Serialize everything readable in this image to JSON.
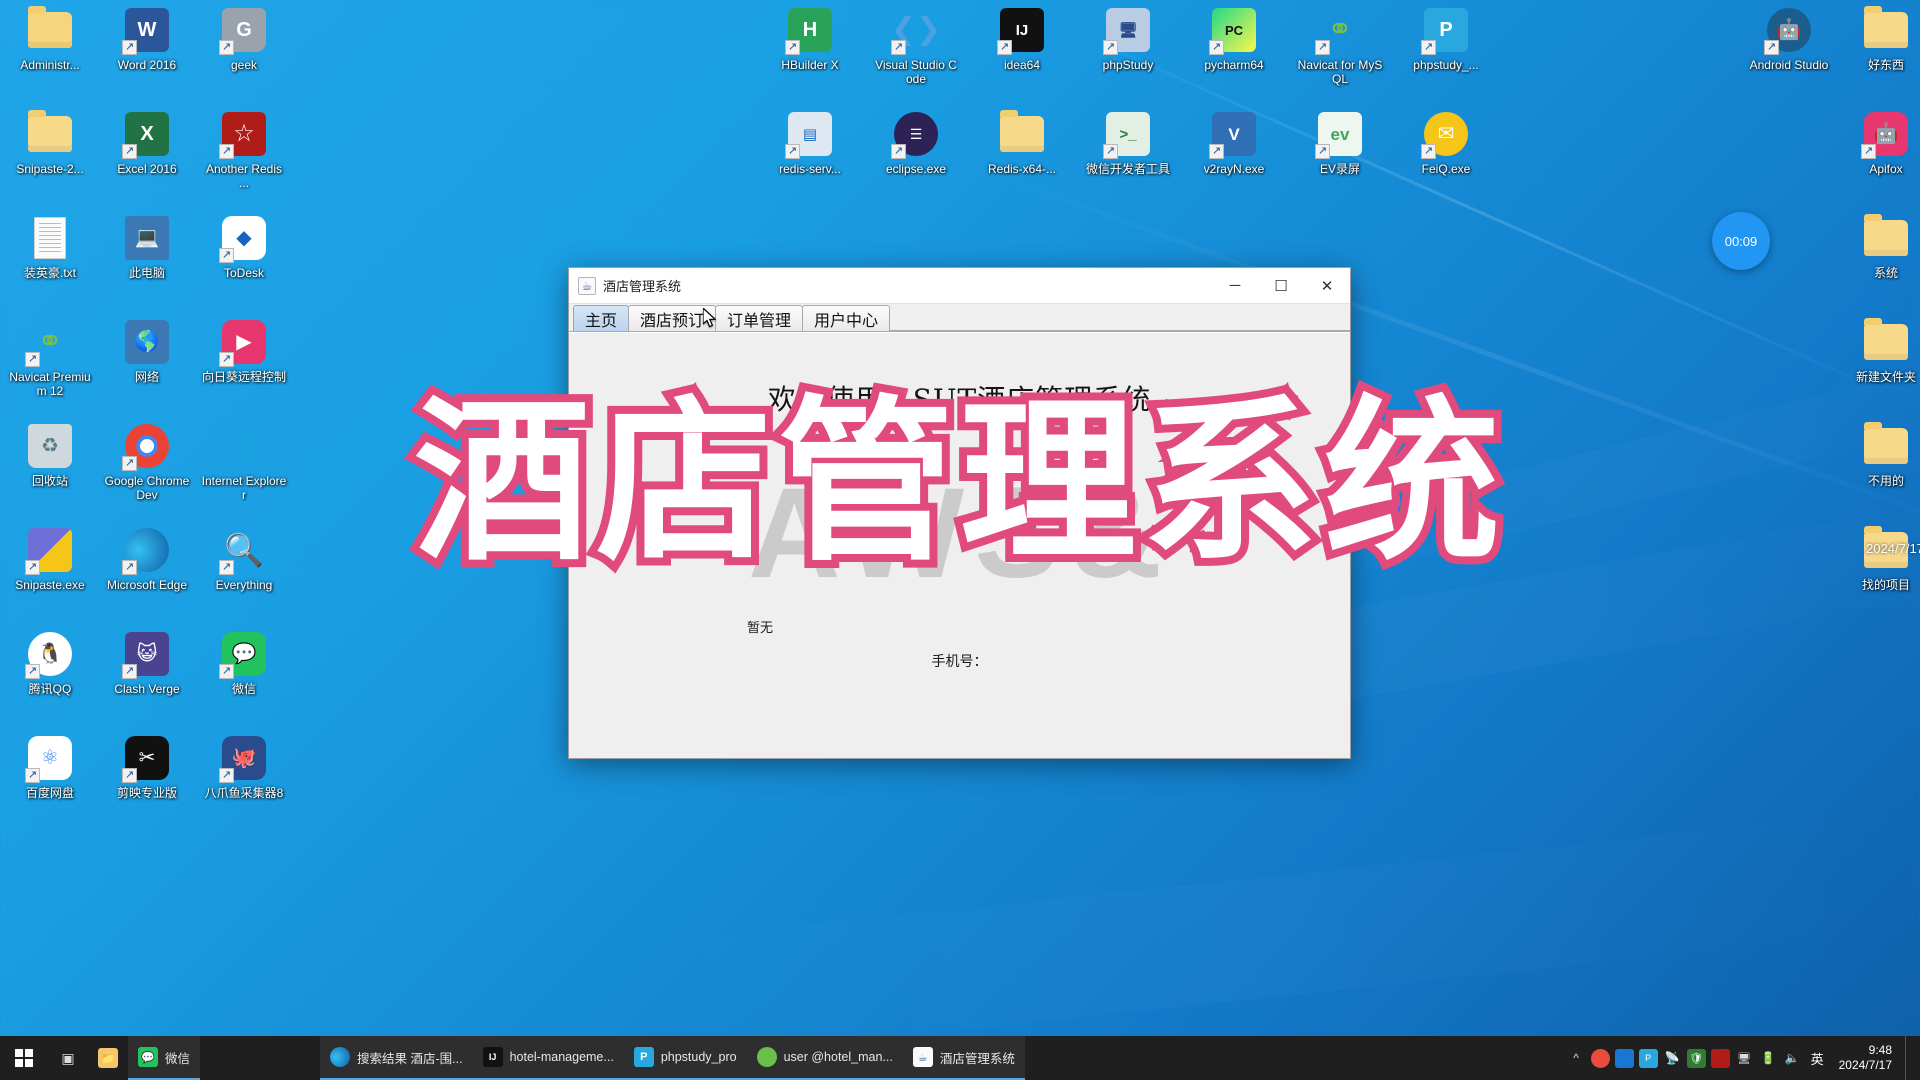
{
  "desktop": {
    "columns": [
      {
        "name": "left-column",
        "icons": [
          {
            "label": "Administr...",
            "icon": "user-folder-icon",
            "kind": "folder-user",
            "shortcut": false
          },
          {
            "label": "Word 2016",
            "icon": "word-icon",
            "kind": "word",
            "shortcut": true
          },
          {
            "label": "geek",
            "icon": "geek-uninstaller-icon",
            "kind": "geek",
            "shortcut": true
          },
          {
            "label": "Snipaste-2...",
            "icon": "folder-icon",
            "kind": "folder",
            "shortcut": false
          },
          {
            "label": "Excel 2016",
            "icon": "excel-icon",
            "kind": "excel",
            "shortcut": true
          },
          {
            "label": "Another Redis ...",
            "icon": "another-redis-desktop-manager-icon",
            "kind": "redis-star",
            "shortcut": true
          },
          {
            "label": "装英豪.txt",
            "icon": "text-file-icon",
            "kind": "txt",
            "shortcut": false
          },
          {
            "label": "此电脑",
            "icon": "this-pc-icon",
            "kind": "pc",
            "shortcut": false
          },
          {
            "label": "ToDesk",
            "icon": "todesk-icon",
            "kind": "todesk",
            "shortcut": true
          },
          {
            "label": "Navicat Premium 12",
            "icon": "navicat-premium-icon",
            "kind": "navicat",
            "shortcut": true
          },
          {
            "label": "网络",
            "icon": "network-icon",
            "kind": "network",
            "shortcut": false
          },
          {
            "label": "向日葵远程控制",
            "icon": "sunlogin-icon",
            "kind": "sunlogin",
            "shortcut": true
          },
          {
            "label": "回收站",
            "icon": "recycle-bin-icon",
            "kind": "recycle",
            "shortcut": false
          },
          {
            "label": "Google Chrome Dev",
            "icon": "chrome-dev-icon",
            "kind": "chrome",
            "shortcut": true
          },
          {
            "label": "Internet Explorer",
            "icon": "internet-explorer-icon",
            "kind": "ie",
            "shortcut": false
          },
          {
            "label": "Snipaste.exe",
            "icon": "snipaste-icon",
            "kind": "snipaste",
            "shortcut": true
          },
          {
            "label": "Microsoft Edge",
            "icon": "microsoft-edge-icon",
            "kind": "edge",
            "shortcut": true
          },
          {
            "label": "Everything",
            "icon": "everything-icon",
            "kind": "everything",
            "shortcut": true
          },
          {
            "label": "腾讯QQ",
            "icon": "tencent-qq-icon",
            "kind": "qq",
            "shortcut": true
          },
          {
            "label": "Clash Verge",
            "icon": "clash-verge-icon",
            "kind": "clash",
            "shortcut": true
          },
          {
            "label": "微信",
            "icon": "wechat-icon",
            "kind": "wechat",
            "shortcut": true
          },
          {
            "label": "百度网盘",
            "icon": "baidu-netdisk-icon",
            "kind": "baidu",
            "shortcut": true
          },
          {
            "label": "剪映专业版",
            "icon": "jianying-icon",
            "kind": "jianying",
            "shortcut": true
          },
          {
            "label": "八爪鱼采集器8",
            "icon": "octopus-collector-icon",
            "kind": "octopus",
            "shortcut": true
          }
        ]
      },
      {
        "name": "center-column",
        "icons": [
          {
            "label": "HBuilder X",
            "icon": "hbuilderx-icon",
            "kind": "hbuilder",
            "shortcut": true
          },
          {
            "label": "Visual Studio Code",
            "icon": "vscode-icon",
            "kind": "vscode",
            "shortcut": true
          },
          {
            "label": "idea64",
            "icon": "intellij-idea-icon",
            "kind": "idea",
            "shortcut": true
          },
          {
            "label": "phpStudy",
            "icon": "phpstudy-icon",
            "kind": "phpstudy-old",
            "shortcut": true
          },
          {
            "label": "pycharm64",
            "icon": "pycharm-icon",
            "kind": "pycharm",
            "shortcut": true
          },
          {
            "label": "Navicat for MySQL",
            "icon": "navicat-mysql-icon",
            "kind": "navicat-mysql",
            "shortcut": true
          },
          {
            "label": "phpstudy_...",
            "icon": "phpstudy-pro-icon",
            "kind": "phpstudy-pro",
            "shortcut": true
          },
          {
            "label": "redis-serv...",
            "icon": "redis-server-icon",
            "kind": "redis-server",
            "shortcut": true
          },
          {
            "label": "eclipse.exe",
            "icon": "eclipse-icon",
            "kind": "eclipse",
            "shortcut": true
          },
          {
            "label": "Redis-x64-...",
            "icon": "folder-icon",
            "kind": "folder",
            "shortcut": false
          },
          {
            "label": "微信开发者工具",
            "icon": "wechat-devtools-icon",
            "kind": "wxdev",
            "shortcut": true
          },
          {
            "label": "v2rayN.exe",
            "icon": "v2rayn-icon",
            "kind": "v2rayn",
            "shortcut": true
          },
          {
            "label": "EV录屏",
            "icon": "ev-recorder-icon",
            "kind": "evcapture",
            "shortcut": true
          },
          {
            "label": "FeiQ.exe",
            "icon": "feiq-icon",
            "kind": "feiq",
            "shortcut": true
          }
        ]
      },
      {
        "name": "right-column",
        "icons": [
          {
            "label": "Android Studio",
            "icon": "android-studio-icon",
            "kind": "android",
            "shortcut": true
          },
          {
            "label": "好东西",
            "icon": "folder-icon",
            "kind": "folder",
            "shortcut": false
          },
          {
            "label": "Apifox",
            "icon": "apifox-icon",
            "kind": "apifox",
            "shortcut": true
          },
          {
            "label": "系统",
            "icon": "folder-icon",
            "kind": "folder",
            "shortcut": false
          },
          {
            "label": "新建文件夹",
            "icon": "folder-icon",
            "kind": "folder",
            "shortcut": false
          },
          {
            "label": "不用的",
            "icon": "folder-icon",
            "kind": "folder",
            "shortcut": false
          },
          {
            "label": "找的项目",
            "icon": "folder-icon",
            "kind": "folder",
            "shortcut": false
          }
        ]
      }
    ],
    "recording_timer": "00:09",
    "recording_date": "2024/7/17"
  },
  "app_window": {
    "title": "酒店管理系统",
    "title_icon": "java-coffee-icon",
    "window_controls": {
      "minimize": "─",
      "maximize": "☐",
      "close": "✕"
    },
    "tabs": [
      {
        "label": "主页",
        "active": true
      },
      {
        "label": "酒店预订",
        "active": false
      },
      {
        "label": "订单管理",
        "active": false
      },
      {
        "label": "用户中心",
        "active": false
      }
    ],
    "content": {
      "welcome_heading": "欢迎使用　SUT酒店管理系统",
      "empty_text": "暂无",
      "phone_label": "手机号："
    }
  },
  "watermark": {
    "main_text": "酒店管理系统",
    "fill_color": "#ffffff",
    "stroke_color": "#e04a7d",
    "background_text": "AWS&"
  },
  "taskbar": {
    "start_label": "start-button",
    "pinned": [
      {
        "label": "任务视图",
        "icon": "task-view-icon",
        "kind": "taskview"
      },
      {
        "label": "文件资源管理器",
        "icon": "file-explorer-icon",
        "kind": "explorer"
      }
    ],
    "tasks": [
      {
        "label": "微信",
        "icon": "wechat-icon",
        "kind": "wechat",
        "running": true
      },
      {
        "label": "搜索结果 酒店-围...",
        "icon": "edge-icon",
        "kind": "edge",
        "running": true
      },
      {
        "label": "hotel-manageme...",
        "icon": "intellij-idea-icon",
        "kind": "idea",
        "running": true
      },
      {
        "label": "phpstudy_pro",
        "icon": "phpstudy-pro-icon",
        "kind": "phpstudy-pro",
        "running": true
      },
      {
        "label": "user @hotel_man...",
        "icon": "navicat-icon",
        "kind": "navicat",
        "running": true
      },
      {
        "label": "酒店管理系统",
        "icon": "java-coffee-icon",
        "kind": "java",
        "running": true
      }
    ],
    "tray_icons": [
      {
        "name": "tray-chevron-icon",
        "kind": "chev"
      },
      {
        "name": "tray-qq-icon",
        "kind": "qq"
      },
      {
        "name": "tray-todesk-icon",
        "kind": "todesk"
      },
      {
        "name": "tray-phpstudy-icon",
        "kind": "php"
      },
      {
        "name": "tray-network-icon",
        "kind": "net"
      },
      {
        "name": "tray-shield-icon",
        "kind": "shield"
      },
      {
        "name": "tray-redis-icon",
        "kind": "redis"
      },
      {
        "name": "tray-monitor-icon",
        "kind": "mon"
      },
      {
        "name": "tray-battery-icon",
        "kind": "bat"
      },
      {
        "name": "tray-volume-icon",
        "kind": "vol"
      }
    ],
    "ime_label": "英",
    "clock_time": "9:48",
    "clock_date": "2024/7/17"
  }
}
